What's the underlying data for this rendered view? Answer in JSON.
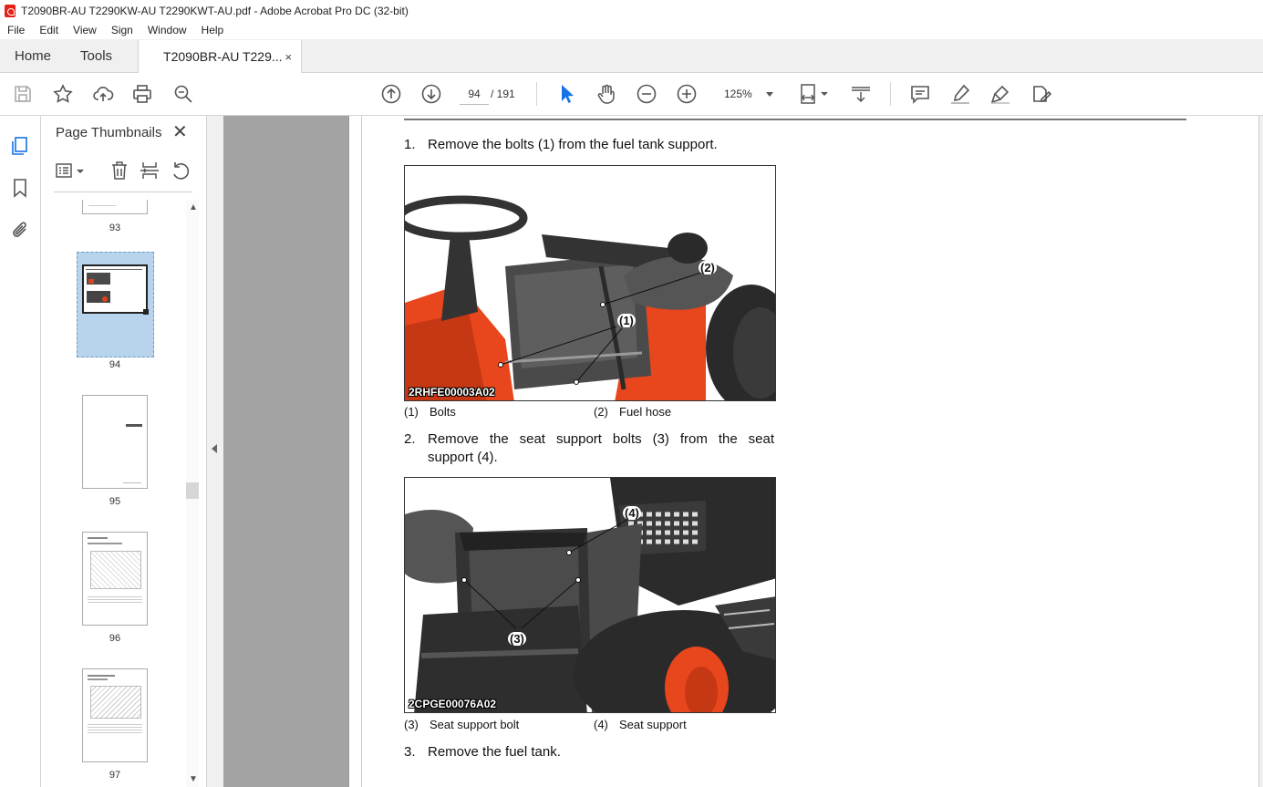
{
  "window": {
    "title": "T2090BR-AU T2290KW-AU T2290KWT-AU.pdf - Adobe Acrobat Pro DC (32-bit)"
  },
  "menu": [
    "File",
    "Edit",
    "View",
    "Sign",
    "Window",
    "Help"
  ],
  "tabs": {
    "home": "Home",
    "tools": "Tools",
    "document": "T2090BR-AU T229...",
    "close": "×"
  },
  "toolbar": {
    "page_current": "94",
    "page_total": "/ 191",
    "zoom": "125%"
  },
  "thumbnails": {
    "title": "Page Thumbnails",
    "close": "✕",
    "pages": [
      "93",
      "94",
      "95",
      "96",
      "97"
    ]
  },
  "document": {
    "step1": {
      "num": "1.",
      "text": "Remove the bolts (1) from the fuel tank support."
    },
    "figure1": {
      "code": "2RHFE00003A02",
      "callouts": [
        "(2)",
        "(1)"
      ]
    },
    "caption1": [
      {
        "num": "(1)",
        "text": "Bolts"
      },
      {
        "num": "(2)",
        "text": "Fuel hose"
      }
    ],
    "step2": {
      "num": "2.",
      "line1": "Remove the seat support bolts (3) from the seat",
      "line2": "support (4)."
    },
    "figure2": {
      "code": "2CPGE00076A02",
      "callouts": [
        "(4)",
        "(3)"
      ]
    },
    "caption2": [
      {
        "num": "(3)",
        "text": "Seat support bolt"
      },
      {
        "num": "(4)",
        "text": "Seat support"
      }
    ],
    "step3": {
      "num": "3.",
      "text": "Remove the fuel tank."
    }
  },
  "colors": {
    "tab_bar": "#f0f0f0",
    "doc_gray": "#a3a3a3",
    "tractor_orange": "#e8461c",
    "selection": "#b8d3ec"
  }
}
